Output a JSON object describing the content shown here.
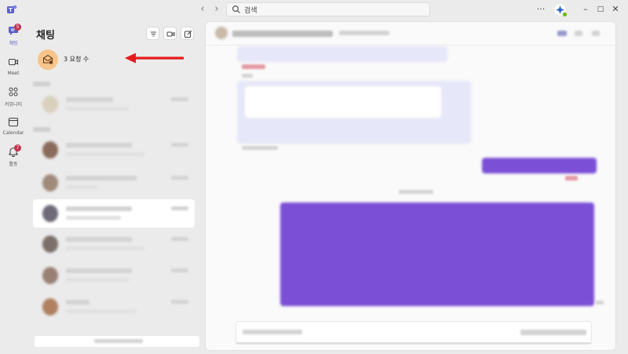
{
  "titlebar": {
    "search": {
      "value": "검색",
      "placeholder": "검색"
    },
    "more": "···"
  },
  "rail": {
    "items": [
      {
        "label": "채팅",
        "badge": "5",
        "icon": "chat-icon",
        "active": true
      },
      {
        "label": "Meet",
        "icon": "video-icon"
      },
      {
        "label": "커뮤니티",
        "icon": "community-icon"
      },
      {
        "label": "Calendar",
        "icon": "calendar-icon"
      },
      {
        "label": "활동",
        "badge": "7",
        "icon": "bell-icon"
      }
    ]
  },
  "chatlist": {
    "title": "채팅",
    "requests_label": "3 요청 수"
  },
  "colors": {
    "accent": "#5b5fc7",
    "badge": "#c4314b",
    "annotation": "#e8191c",
    "bubble_sent": "#7b4fd6",
    "bubble_received": "#e6e7f8"
  }
}
